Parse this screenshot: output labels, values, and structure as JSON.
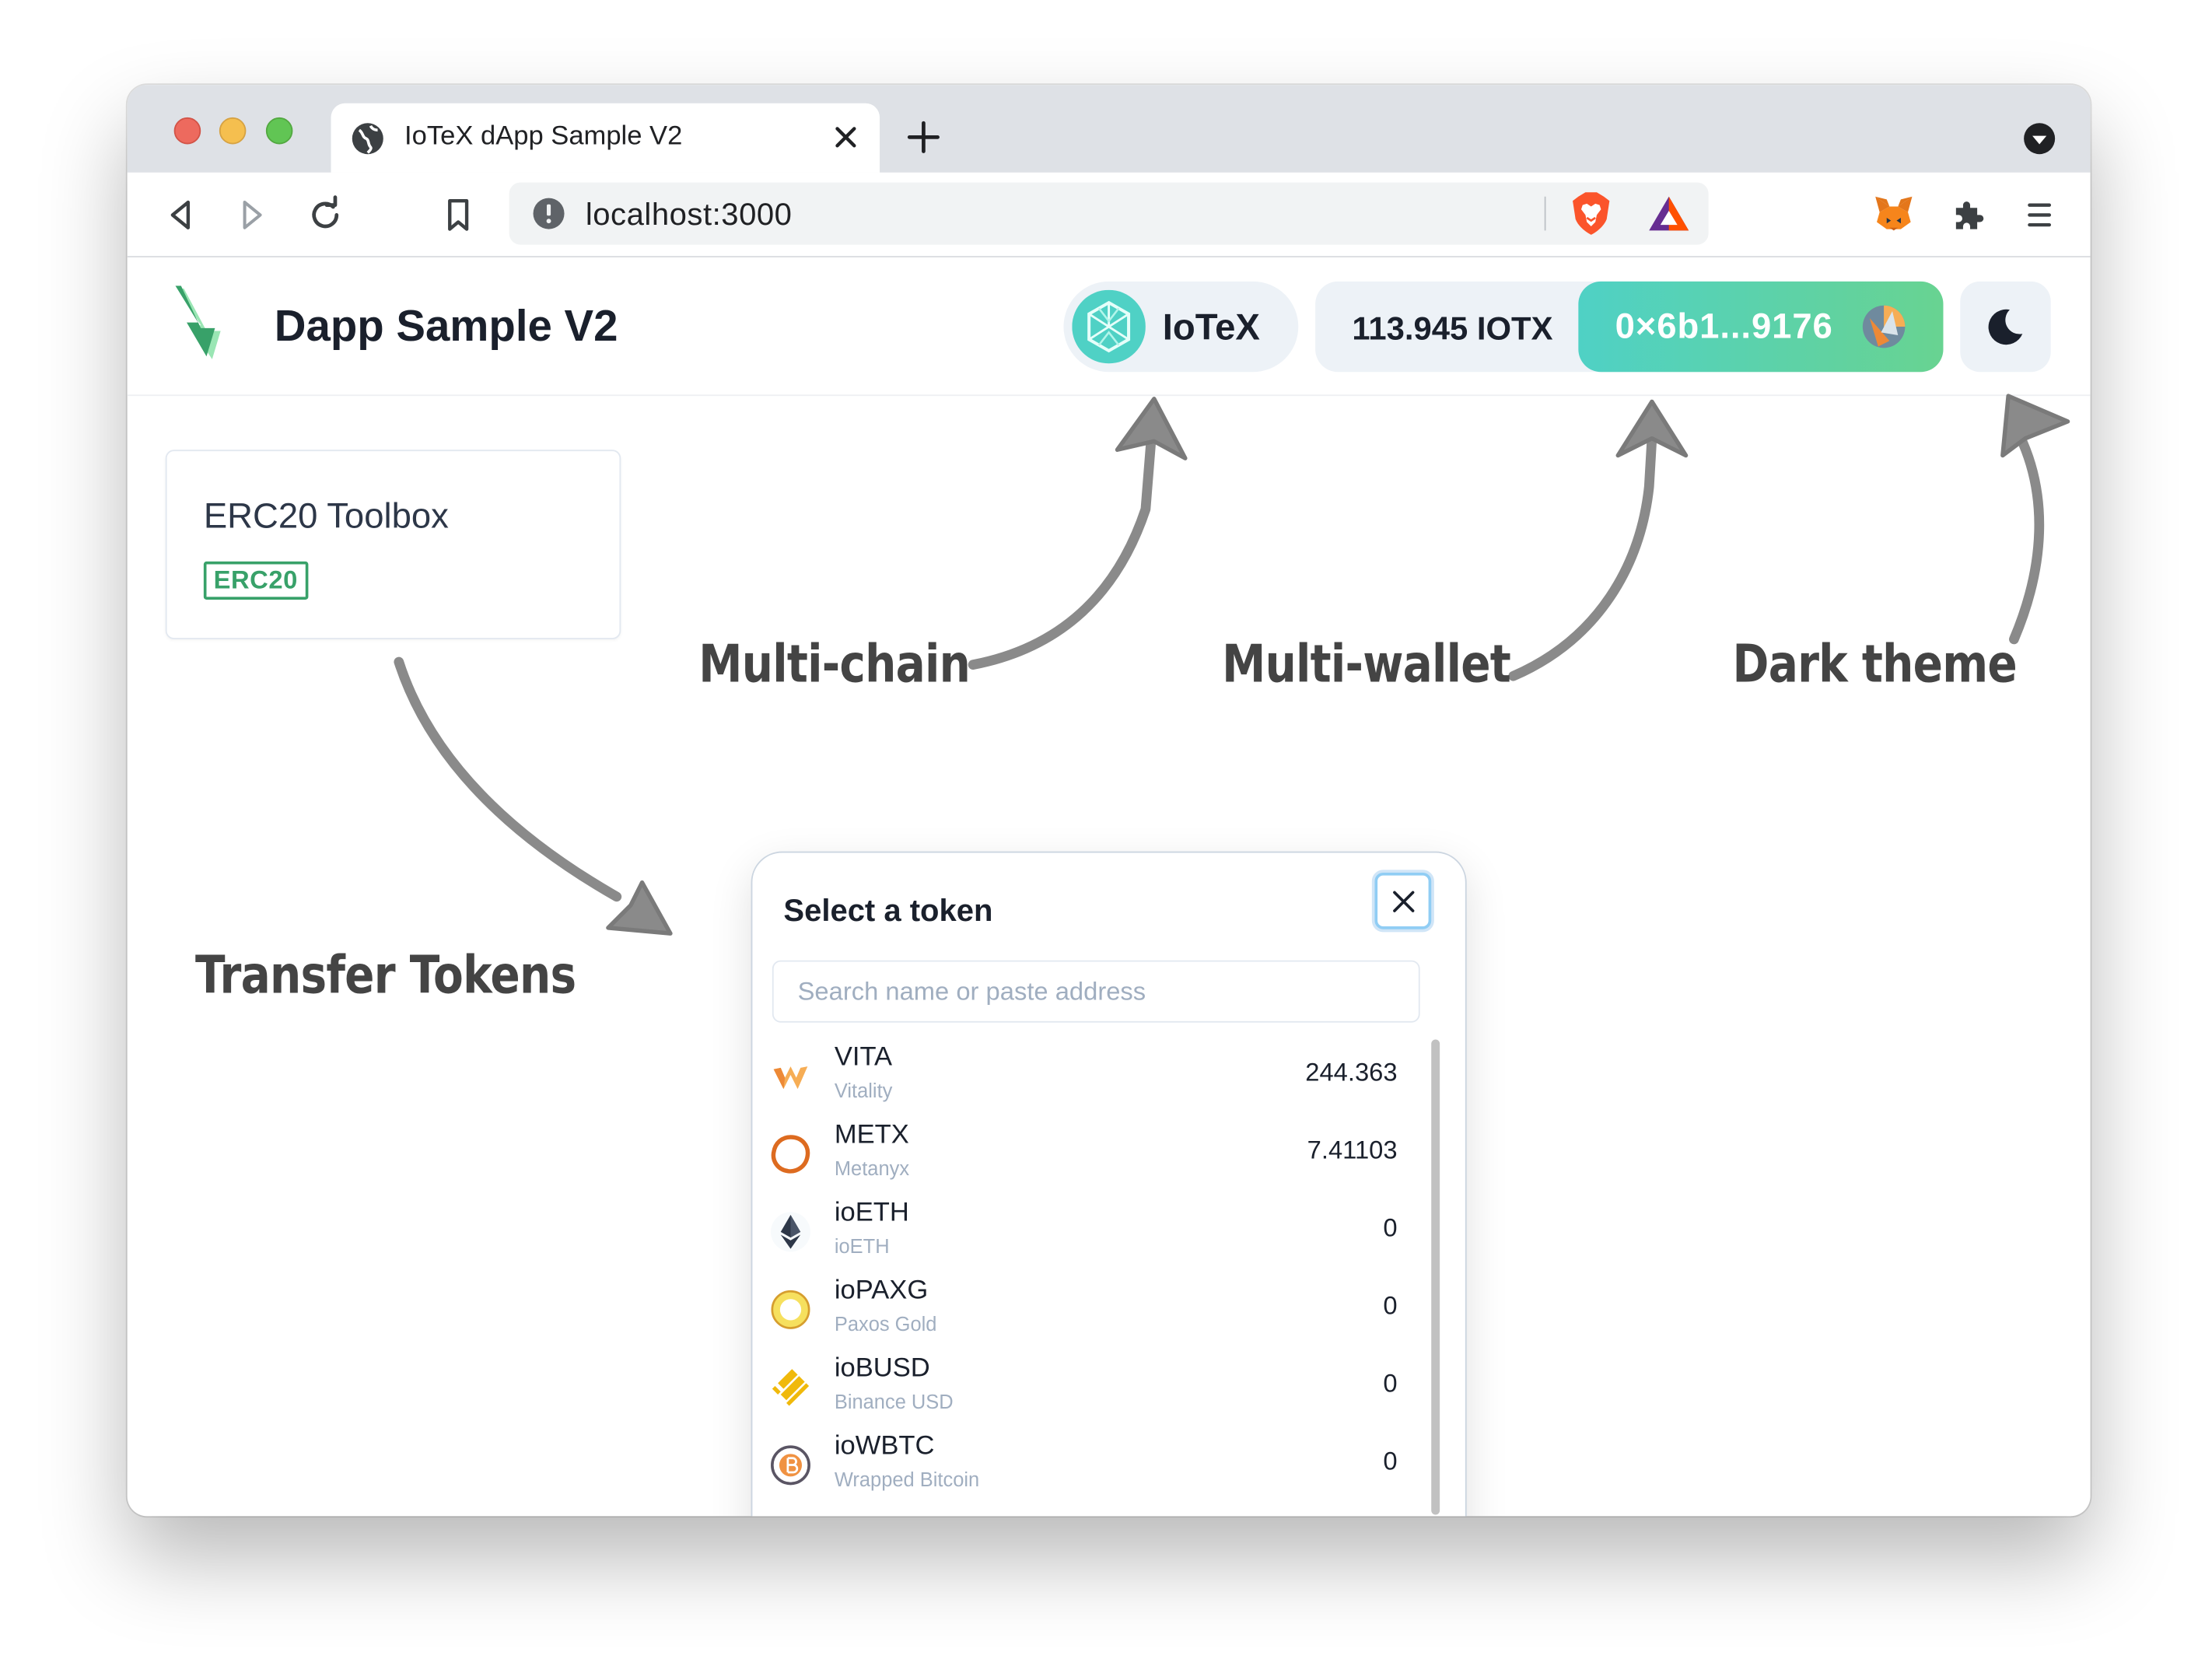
{
  "browser": {
    "tab_title": "IoTeX dApp Sample V2",
    "url": "localhost:3000"
  },
  "header": {
    "app_title": "Dapp Sample V2",
    "chain_label": "IoTeX",
    "balance": "113.945 IOTX",
    "address": "0×6b1...9176"
  },
  "card": {
    "title": "ERC20 Toolbox",
    "badge": "ERC20"
  },
  "annotations": {
    "multichain": "Multi-chain",
    "multiwallet": "Multi-wallet",
    "darktheme": "Dark theme",
    "transfer": "Transfer Tokens"
  },
  "modal": {
    "title": "Select a token",
    "search_placeholder": "Search name or paste address",
    "tokens": [
      {
        "symbol": "VITA",
        "name": "Vitality",
        "balance": "244.363",
        "icon": "vita-icon"
      },
      {
        "symbol": "METX",
        "name": "Metanyx",
        "balance": "7.41103",
        "icon": "metx-icon"
      },
      {
        "symbol": "ioETH",
        "name": "ioETH",
        "balance": "0",
        "icon": "eth-icon"
      },
      {
        "symbol": "ioPAXG",
        "name": "Paxos Gold",
        "balance": "0",
        "icon": "paxg-icon"
      },
      {
        "symbol": "ioBUSD",
        "name": "Binance USD",
        "balance": "0",
        "icon": "busd-icon"
      },
      {
        "symbol": "ioWBTC",
        "name": "Wrapped Bitcoin",
        "balance": "0",
        "icon": "wbtc-icon"
      }
    ]
  },
  "colors": {
    "accent_gradient_start": "#4fd1c5",
    "accent_gradient_end": "#68d391",
    "badge_green": "#38a169",
    "annotation_gray": "#444444"
  }
}
